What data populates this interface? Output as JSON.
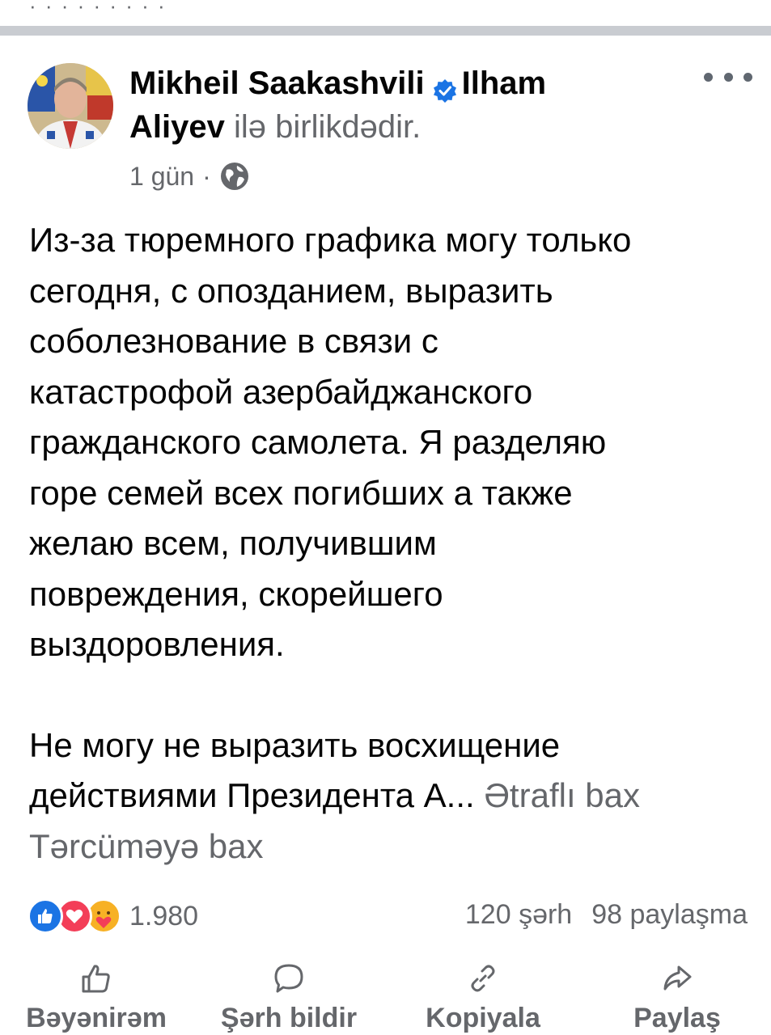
{
  "previous_post": {
    "remnant_text": "·   ·   ·   ·   ·   ·   ·   ·   ·"
  },
  "post": {
    "author": "Mikheil Saakashvili",
    "tagged_person": "Ilham",
    "tagged_person_cont": "Aliyev",
    "with_text": "ilə birlikdədir.",
    "time": "1 gün",
    "separator": "·",
    "body_lines_p1": [
      "Из-за тюремного графика могу только",
      "сегодня, с опозданием, выразить",
      "соболезнование в связи с",
      "катастрофой азербайджанского",
      "гражданского самолета. Я разделяю",
      "горе семей всех погибших а также",
      "желаю всем, получившим",
      "повреждения, скорейшего",
      "выздоровления."
    ],
    "body_lines_p2": [
      "Не могу не выразить восхищение",
      "действиями Президента А..."
    ],
    "see_more": "Ətraflı bax",
    "translate": "Tərcüməyə bax"
  },
  "stats": {
    "reactions_count": "1.980",
    "comments": "120 şərh",
    "shares": "98 paylaşma"
  },
  "actions": {
    "like": "Bəyənirəm",
    "comment": "Şərh bildir",
    "copy": "Kopiyala",
    "share": "Paylaş"
  },
  "icons": {
    "verified": "verified-badge-icon",
    "globe": "globe-icon",
    "more": "more-options-icon",
    "like": "thumbs-up-icon",
    "comment": "comment-bubble-icon",
    "copy": "link-icon",
    "share": "share-arrow-icon"
  },
  "colors": {
    "secondary_text": "#65676b",
    "like_blue": "#1b74e4",
    "love_red": "#f33e58",
    "care_yellow": "#f7b125",
    "divider": "#c9ccd1"
  }
}
